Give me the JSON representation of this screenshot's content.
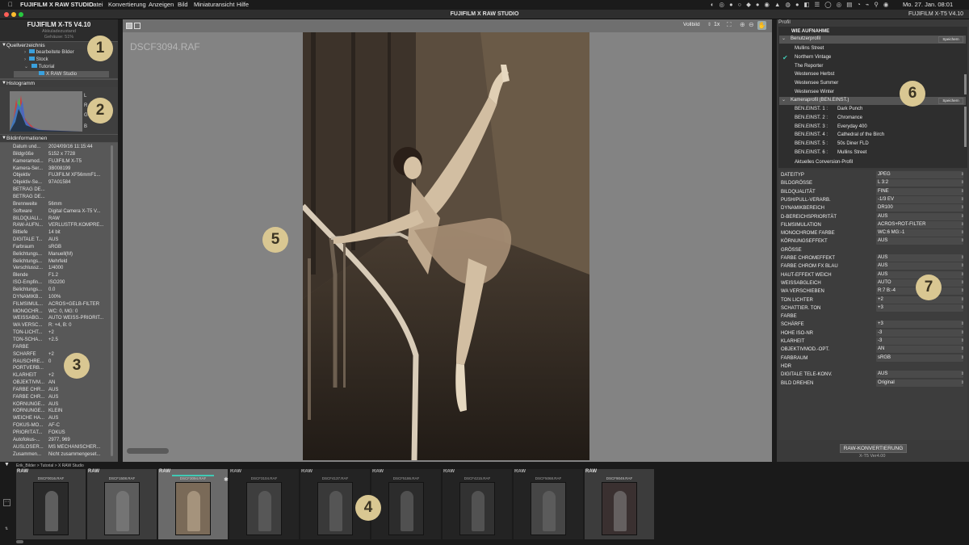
{
  "menubar": {
    "app": "FUJIFILM X RAW STUDIO",
    "items": [
      "Datei",
      "Konvertierung",
      "Anzeigen",
      "Bild",
      "Miniaturansicht",
      "Hilfe"
    ],
    "clock": "Mo. 27. Jan.  08:01"
  },
  "window": {
    "title": "FUJIFILM X RAW STUDIO",
    "camera_right": "FUJIFILM X-T5    V4.10"
  },
  "left": {
    "camera": "FUJIFILM X-T5     V4.10",
    "status_1": "Akkuladezustand",
    "status_2": "Gehäuse: 51%",
    "source_header": "Quellverzeichnis",
    "folders": [
      "bearbeitete Bilder",
      "Stock",
      "Tutorial",
      "X RAW Studio"
    ],
    "histogram_header": "Histogramm",
    "hist_labels": [
      "L",
      "R",
      "G",
      "B"
    ],
    "info_header": "Bildinformationen",
    "info": [
      [
        "Datum und...",
        "2024/09/16 11:15:44"
      ],
      [
        "Bildgröße",
        "5152 x 7728"
      ],
      [
        "Kameramod...",
        "FUJIFILM X-T5"
      ],
      [
        "Kamera-Ser...",
        "3B008199"
      ],
      [
        "Objektiv",
        "FUJIFILM XF56mmF1..."
      ],
      [
        "Objektiv-Se...",
        "97A01584"
      ],
      [
        "BETRAG DE...",
        ""
      ],
      [
        "BETRAG DE...",
        ""
      ],
      [
        "Brennweite",
        "56mm"
      ],
      [
        "Software",
        "Digital Camera X-T5 V..."
      ],
      [
        "BILDQUALI...",
        "RAW"
      ],
      [
        "RAW-AUFN...",
        "VERLUSTFR.KOMPRE..."
      ],
      [
        "Bittiefe",
        "14 bit"
      ],
      [
        "DIGITALE  T...",
        "AUS"
      ],
      [
        "Farbraum",
        "sRGB"
      ],
      [
        "Belichtungs...",
        "Manuell(M)"
      ],
      [
        "Belichtungs...",
        "Mehrfeld"
      ],
      [
        "Verschlussz...",
        "1/4000"
      ],
      [
        "Blende",
        "F1.2"
      ],
      [
        "ISO-Empfin...",
        "ISO200"
      ],
      [
        "Belichtungs...",
        "0.0"
      ],
      [
        "DYNAMIKB...",
        "100%"
      ],
      [
        "FILMSIMUL...",
        "ACROS+GELB-FILTER"
      ],
      [
        "MONOCHR...",
        "WC: 0, MG: 0"
      ],
      [
        "WEISSABG...",
        "AUTO WEISS-PRIORIT..."
      ],
      [
        "WA VERSC...",
        "R: +4, B: 0"
      ],
      [
        "TON-LICHT...",
        "+2"
      ],
      [
        "TON-SCHA...",
        "+2.5"
      ],
      [
        "FARBE",
        ""
      ],
      [
        "SCHÄRFE",
        "+2"
      ],
      [
        "RAUSCHRE...",
        "0"
      ],
      [
        "PORTVERB...",
        ""
      ],
      [
        "KLARHEIT",
        "+2"
      ],
      [
        "OBJEKTIVM...",
        "AN"
      ],
      [
        "FARBE CHR...",
        "AUS"
      ],
      [
        "FARBE CHR...",
        "AUS"
      ],
      [
        "KÖRNUNGE...",
        "AUS"
      ],
      [
        "KÖRNUNGE...",
        "KLEIN"
      ],
      [
        "WEICHE HA...",
        "AUS"
      ],
      [
        "FOKUS-MO...",
        "AF-C"
      ],
      [
        "PRIORITÄT...",
        "FOKUS"
      ],
      [
        "Autofokus-...",
        "2977, 969"
      ],
      [
        "AUSLÖSER...",
        "MS MECHANISCHER..."
      ],
      [
        "Zusammen...",
        "Nicht zusammengeset..."
      ]
    ]
  },
  "viewer": {
    "filename": "DSCF3094.RAF",
    "view_mode": "Vollbild",
    "zoom": "1x"
  },
  "right": {
    "profil_header": "Profil",
    "as_shot": "WIE AUFNAHME",
    "user_header": "Benutzerprofil",
    "save_label": "Speichern",
    "user_profiles": [
      "Mullins Street",
      "Northern Vintage",
      "The Reporter",
      "Westensee Herbst",
      "Westensee Summer",
      "Westensee Winter"
    ],
    "cam_header": "Kameraprofil (BEN.EINST.)",
    "cam_profiles": [
      [
        "BEN.EINST. 1 :",
        "Dark Punch"
      ],
      [
        "BEN.EINST. 2 :",
        "Chromance"
      ],
      [
        "BEN.EINST. 3 :",
        "Everyday 400"
      ],
      [
        "BEN.EINST. 4 :",
        "Cathedral of the Birch"
      ],
      [
        "BEN.EINST. 5 :",
        "50s Diner FLD"
      ],
      [
        "BEN.EINST. 6 :",
        "Mullins Street"
      ]
    ],
    "current_profile": "Aktuelles Conversion-Profil",
    "settings": [
      [
        "DATEITYP",
        "JPEG"
      ],
      [
        "BILDGRÖSSE",
        "L 3:2"
      ],
      [
        "BILDQUALITÄT",
        "FINE"
      ],
      [
        "PUSH/PULL-VERARB.",
        "-1/3 EV"
      ],
      [
        "DYNAMIKBEREICH",
        "DR100"
      ],
      [
        "D-BEREICHSPRIORITÄT",
        "AUS"
      ],
      [
        "FILMSIMULATION",
        "ACROS+ROT-FILTER"
      ],
      [
        "MONOCHROME FARBE",
        "WC:6 MG:-1"
      ],
      [
        "KÖRNUNGSEFFEKT",
        "AUS"
      ],
      [
        "GRÖSSE",
        ""
      ],
      [
        "FARBE CHROMEFFEKT",
        "AUS"
      ],
      [
        "FARBE CHROM FX BLAU",
        "AUS"
      ],
      [
        "HAUT-EFFEKT WEICH",
        "AUS"
      ],
      [
        "WEISSABGLEICH",
        "AUTO"
      ],
      [
        "WA VERSCHIEBEN",
        "R:7 B:-4"
      ],
      [
        "TON LICHTER",
        "+2"
      ],
      [
        "SCHATTIER. TON",
        "+3"
      ],
      [
        "FARBE",
        ""
      ],
      [
        "SCHÄRFE",
        "+3"
      ],
      [
        "HOHE ISO-NR",
        "-3"
      ],
      [
        "KLARHEIT",
        "-3"
      ],
      [
        "OBJEKTIVMOD.-OPT.",
        "AN"
      ],
      [
        "FARBRAUM",
        "sRGB"
      ],
      [
        "HDR",
        ""
      ],
      [
        "DIGITALE  TELE-KONV.",
        "AUS"
      ],
      [
        "BILD DREHEN",
        "Original"
      ]
    ],
    "convert_button": "RAW-KONVERTIERUNG",
    "version": "X-T5 Ver4.00"
  },
  "filmstrip": {
    "path": "Erik_Bilder > Tutorial > X RAW Studio",
    "raw_label": "RAW",
    "thumbs": [
      "DSCF0016.RAF",
      "DSCF1508.RAF",
      "DSCF3094.RAF",
      "DSCF3104.RAF",
      "DSCF4137.RAF",
      "DSCF5186.RAF",
      "DSCF4215.RAF",
      "DSCF5068.RAF",
      "DSCF9049.RAF"
    ],
    "selected_index": 2
  },
  "badges": [
    "1",
    "2",
    "3",
    "4",
    "5",
    "6",
    "7"
  ],
  "colors": {
    "accent": "#40c9b4",
    "badge": "#d9c792"
  }
}
